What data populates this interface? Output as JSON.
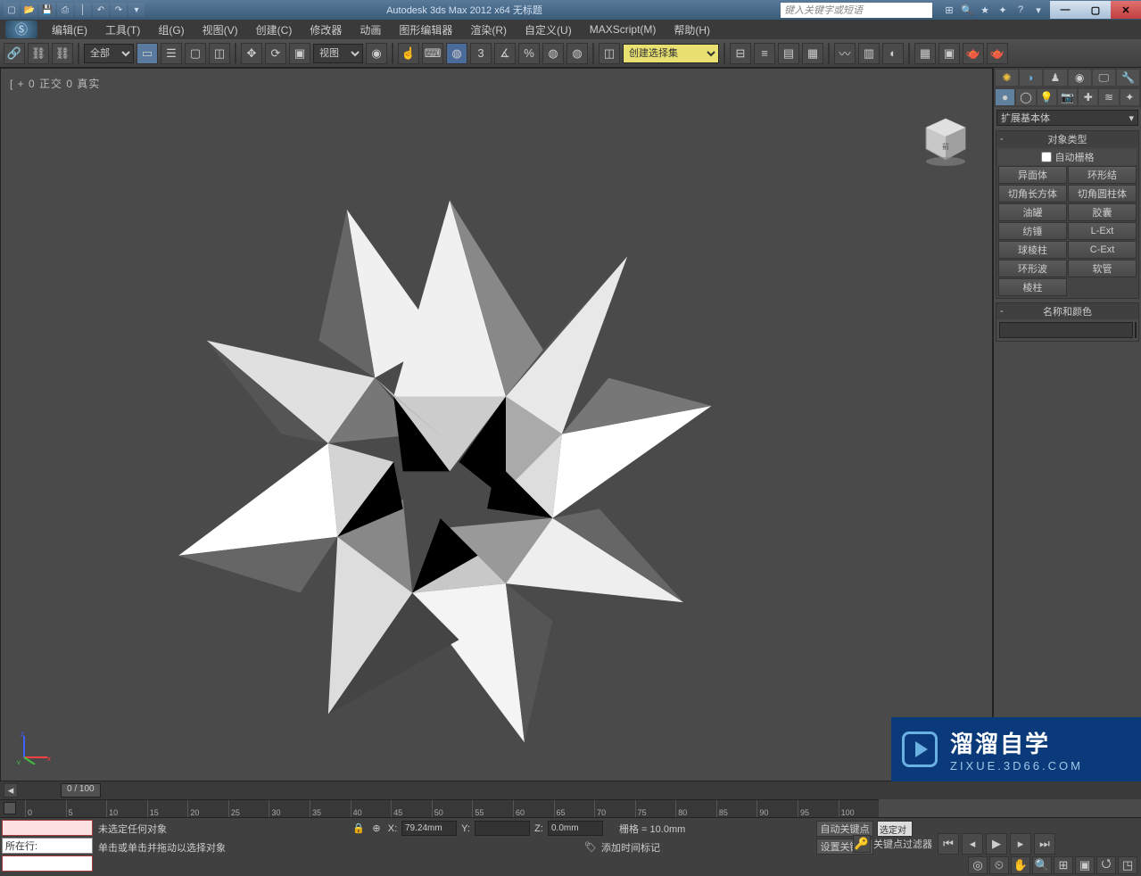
{
  "title": "Autodesk 3ds Max  2012 x64        无标题",
  "search_placeholder": "键入关键字或短语",
  "qat": [
    "▯",
    "▯",
    "▯",
    "▯",
    "|",
    "↶",
    "↷",
    "▾"
  ],
  "help_icons": [
    "⊞",
    "🔍",
    "★",
    "✦",
    "?",
    "▾"
  ],
  "menubar": [
    "编辑(E)",
    "工具(T)",
    "组(G)",
    "视图(V)",
    "创建(C)",
    "修改器",
    "动画",
    "图形编辑器",
    "渲染(R)",
    "自定义(U)",
    "MAXScript(M)",
    "帮助(H)"
  ],
  "toolbar": {
    "filter": "全部",
    "view_select": "视图",
    "named_sel": "创建选择集"
  },
  "viewport_label": "[ + 0  正交  0 真实",
  "cmd_panel": {
    "dropdown": "扩展基本体",
    "rollout1_title": "对象类型",
    "auto_grid_label": "自动栅格",
    "obj_buttons": [
      "异面体",
      "环形结",
      "切角长方体",
      "切角圆柱体",
      "油罐",
      "胶囊",
      "纺锤",
      "L-Ext",
      "球棱柱",
      "C-Ext",
      "环形波",
      "软管",
      "棱柱",
      ""
    ],
    "rollout2_title": "名称和颜色",
    "name_value": ""
  },
  "time_slider": "0 / 100",
  "track_marks": [
    "0",
    "5",
    "10",
    "15",
    "20",
    "25",
    "30",
    "35",
    "40",
    "45",
    "50",
    "55",
    "60",
    "65",
    "70",
    "75",
    "80",
    "85",
    "90",
    "95",
    "100"
  ],
  "status": {
    "sel_info": "未选定任何对象",
    "prompt": "单击或单击并拖动以选择对象",
    "mx_label": "所在行:",
    "coord_x": "79.24mm",
    "coord_y": "",
    "coord_z": "0.0mm",
    "grid": "栅格 = 10.0mm",
    "add_time_tag": "添加时间标记",
    "auto_key": "自动关键点",
    "set_key": "设置关键点",
    "selected": "选定对",
    "key_filter": "关键点过滤器"
  },
  "watermark": {
    "big": "溜溜自学",
    "small": "ZIXUE.3D66.COM"
  }
}
